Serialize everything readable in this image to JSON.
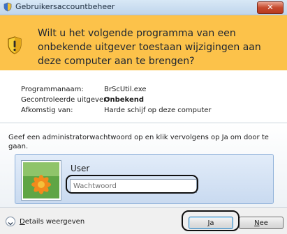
{
  "window": {
    "title": "Gebruikersaccountbeheer",
    "close_label": "✕"
  },
  "banner": {
    "question": "Wilt u het volgende programma van een onbekende uitgever toestaan wijzigingen aan deze computer aan te brengen?"
  },
  "details": [
    {
      "label": "Programmanaam:",
      "value": "BrScUtil.exe",
      "bold": false
    },
    {
      "label": "Gecontroleerde uitgever:",
      "value": "Onbekend",
      "bold": true
    },
    {
      "label": "Afkomstig van:",
      "value": "Harde schijf op deze computer",
      "bold": false
    }
  ],
  "instruction": "Geef een administratorwachtwoord op en klik vervolgens op Ja om door te gaan.",
  "credential": {
    "username": "User",
    "password_placeholder": "Wachtwoord",
    "password_value": ""
  },
  "footer": {
    "details_prefix": "D",
    "details_rest": "etails weergeven",
    "yes_prefix": "J",
    "yes_rest": "a",
    "no_prefix": "N",
    "no_rest": "ee"
  },
  "colors": {
    "banner": "#fcc24a",
    "close_button": "#c64a2e",
    "highlight_outline": "#111111"
  },
  "icons": [
    "uac-shield-icon",
    "warning-shield-icon",
    "user-avatar-flower",
    "chevron-down-icon"
  ]
}
